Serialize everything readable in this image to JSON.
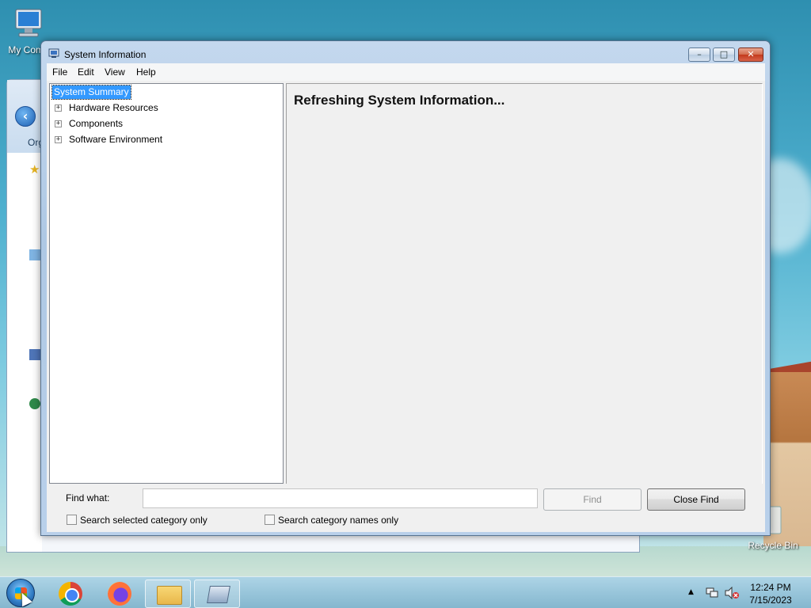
{
  "desktop": {
    "icons": [
      {
        "label": "My Comp",
        "icon": "computer-icon"
      },
      {
        "label": "Recycle Bin",
        "icon": "recycle-bin-icon"
      }
    ]
  },
  "explorer": {
    "organize_label": "Org"
  },
  "window": {
    "title": "System Information",
    "minimize": "–",
    "maximize": "□",
    "close": "✕"
  },
  "menu": [
    "File",
    "Edit",
    "View",
    "Help"
  ],
  "tree": {
    "items": [
      {
        "label": "System Summary",
        "selected": true,
        "expandable": false
      },
      {
        "label": "Hardware Resources",
        "selected": false,
        "expandable": true
      },
      {
        "label": "Components",
        "selected": false,
        "expandable": true
      },
      {
        "label": "Software Environment",
        "selected": false,
        "expandable": true
      }
    ],
    "expander_glyph": "+"
  },
  "detail": {
    "message": "Refreshing System Information..."
  },
  "find": {
    "label": "Find what:",
    "value": "",
    "find_button": "Find",
    "find_enabled": false,
    "close_button": "Close Find",
    "search_selected_label": "Search selected category only",
    "search_selected_checked": false,
    "search_names_label": "Search category names only",
    "search_names_checked": false
  },
  "taskbar": {
    "apps": [
      {
        "name": "Google Chrome",
        "icon": "chrome-icon"
      },
      {
        "name": "Firefox",
        "icon": "firefox-icon"
      },
      {
        "name": "Windows Explorer",
        "icon": "folder-icon",
        "active": true
      },
      {
        "name": "System Information",
        "icon": "system-information-icon",
        "active": true
      }
    ],
    "tray": {
      "show_hidden": "▲",
      "network": "network-icon",
      "volume": "volume-muted-icon"
    },
    "clock": {
      "time": "12:24 PM",
      "date": "7/15/2023"
    }
  }
}
